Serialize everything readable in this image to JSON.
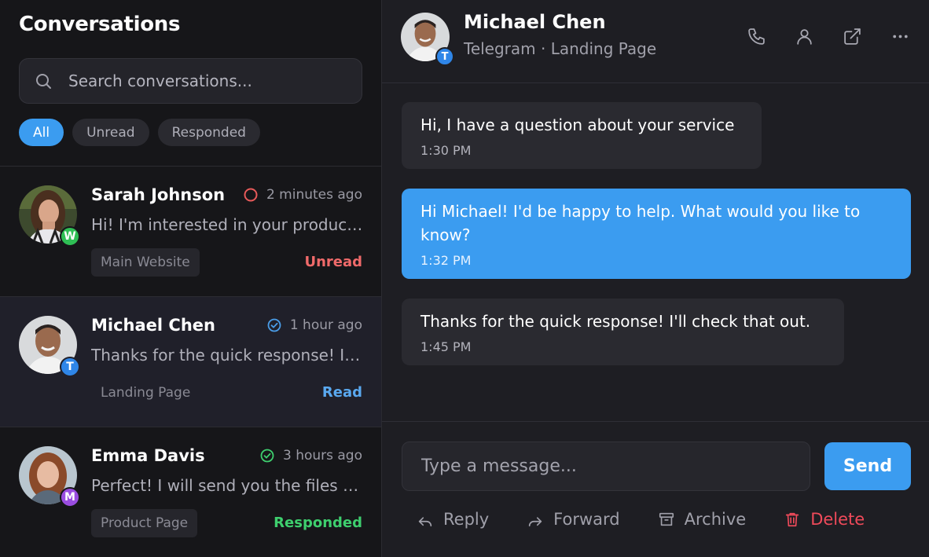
{
  "sidebar": {
    "title": "Conversations",
    "search": {
      "placeholder": "Search conversations..."
    },
    "filters": [
      {
        "label": "All",
        "active": true
      },
      {
        "label": "Unread",
        "active": false
      },
      {
        "label": "Responded",
        "active": false
      }
    ],
    "conversations": [
      {
        "name": "Sarah Johnson",
        "time": "2 minutes ago",
        "preview": "Hi! I'm interested in your product and would like to learn more",
        "source": "Main Website",
        "status": "Unread",
        "status_color": "#f06a6a",
        "channel_badge": "W",
        "badge_color": "#2fbf55",
        "indicator_icon": "unread-circle-icon"
      },
      {
        "name": "Michael Chen",
        "time": "1 hour ago",
        "preview": "Thanks for the quick response! I'll check that out.",
        "source": "Landing Page",
        "status": "Read",
        "status_color": "#5aa9f0",
        "channel_badge": "T",
        "badge_color": "#2f86e8",
        "indicator_icon": "read-check-icon"
      },
      {
        "name": "Emma Davis",
        "time": "3 hours ago",
        "preview": "Perfect! I will send you the files tomorrow morning.",
        "source": "Product Page",
        "status": "Responded",
        "status_color": "#3ecf6e",
        "channel_badge": "M",
        "badge_color": "#9a4de0",
        "indicator_icon": "responded-check-icon"
      }
    ]
  },
  "chat": {
    "contact_name": "Michael Chen",
    "contact_sub": "Telegram · Landing Page",
    "channel_badge": "T",
    "header_icons": [
      "phone-icon",
      "user-icon",
      "external-link-icon",
      "more-icon"
    ],
    "messages": [
      {
        "from": "contact",
        "text": "Hi, I have a question about your service",
        "time": "1:30 PM"
      },
      {
        "from": "agent",
        "text": "Hi Michael! I'd be happy to help. What would you like to know?",
        "time": "1:32 PM"
      },
      {
        "from": "contact",
        "text": "Thanks for the quick response! I'll check that out.",
        "time": "1:45 PM"
      }
    ],
    "composer": {
      "placeholder": "Type a message...",
      "send_label": "Send"
    },
    "actions": [
      {
        "label": "Reply",
        "icon": "reply-icon"
      },
      {
        "label": "Forward",
        "icon": "forward-icon"
      },
      {
        "label": "Archive",
        "icon": "archive-icon"
      },
      {
        "label": "Delete",
        "icon": "trash-icon"
      }
    ]
  },
  "colors": {
    "accent": "#3b9cf0",
    "background": "#1e1e23",
    "sidebar_bg": "#161619",
    "danger": "#ef4a5a"
  }
}
